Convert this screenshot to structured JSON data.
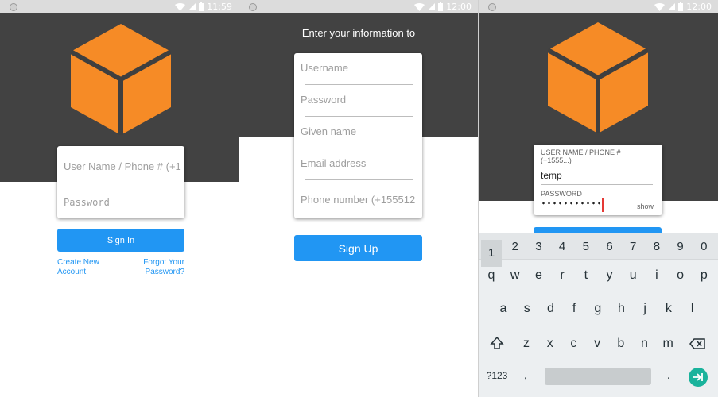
{
  "colors": {
    "accent": "#2196f3",
    "dark_bg": "#424242",
    "cube_orange": "#f68b26",
    "cube_edge": "#3f3f3f",
    "enter_teal": "#1ab39c"
  },
  "panel1": {
    "status_time": "11:59",
    "card": {
      "username_placeholder": "User Name / Phone # (+1",
      "password_placeholder": "Password"
    },
    "sign_in_label": "Sign In",
    "create_account": [
      "Create New",
      "Account"
    ],
    "forgot_password": [
      "Forgot Your",
      "Password?"
    ]
  },
  "panel2": {
    "status_time": "12:00",
    "heading": "Enter your information to",
    "fields": [
      "Username",
      "Password",
      "Given name",
      "Email address",
      "Phone number (+155512"
    ],
    "sign_up_label": "Sign Up"
  },
  "panel3": {
    "status_time": "12:00",
    "username_label": [
      "USER NAME / PHONE #",
      "(+1555...)"
    ],
    "username_value": "temp",
    "password_label": "PASSWORD",
    "show_label": "show",
    "keyboard": {
      "numbers": [
        "1",
        "2",
        "3",
        "4",
        "5",
        "6",
        "7",
        "8",
        "9",
        "0"
      ],
      "row1": [
        "q",
        "w",
        "e",
        "r",
        "t",
        "y",
        "u",
        "i",
        "o",
        "p"
      ],
      "row2": [
        "a",
        "s",
        "d",
        "f",
        "g",
        "h",
        "j",
        "k",
        "l"
      ],
      "row3": [
        "z",
        "x",
        "c",
        "v",
        "b",
        "n",
        "m"
      ],
      "symbols_label": "?123",
      "comma": ",",
      "period": "."
    }
  }
}
